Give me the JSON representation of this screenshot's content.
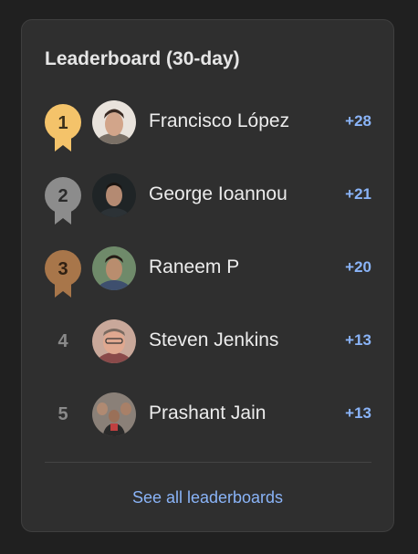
{
  "leaderboard": {
    "title": "Leaderboard (30-day)",
    "see_all_label": "See all leaderboards",
    "entries": [
      {
        "rank": "1",
        "name": "Francisco López",
        "score": "+28",
        "medal": "gold",
        "medal_color": "#f4c36a"
      },
      {
        "rank": "2",
        "name": "George Ioannou",
        "score": "+21",
        "medal": "silver",
        "medal_color": "#8c8c8c"
      },
      {
        "rank": "3",
        "name": "Raneem P",
        "score": "+20",
        "medal": "bronze",
        "medal_color": "#a8764a"
      },
      {
        "rank": "4",
        "name": "Steven Jenkins",
        "score": "+13"
      },
      {
        "rank": "5",
        "name": "Prashant Jain",
        "score": "+13"
      }
    ]
  },
  "colors": {
    "accent": "#8ab4f8",
    "card_bg": "#2f2f2f",
    "page_bg": "#202020"
  }
}
